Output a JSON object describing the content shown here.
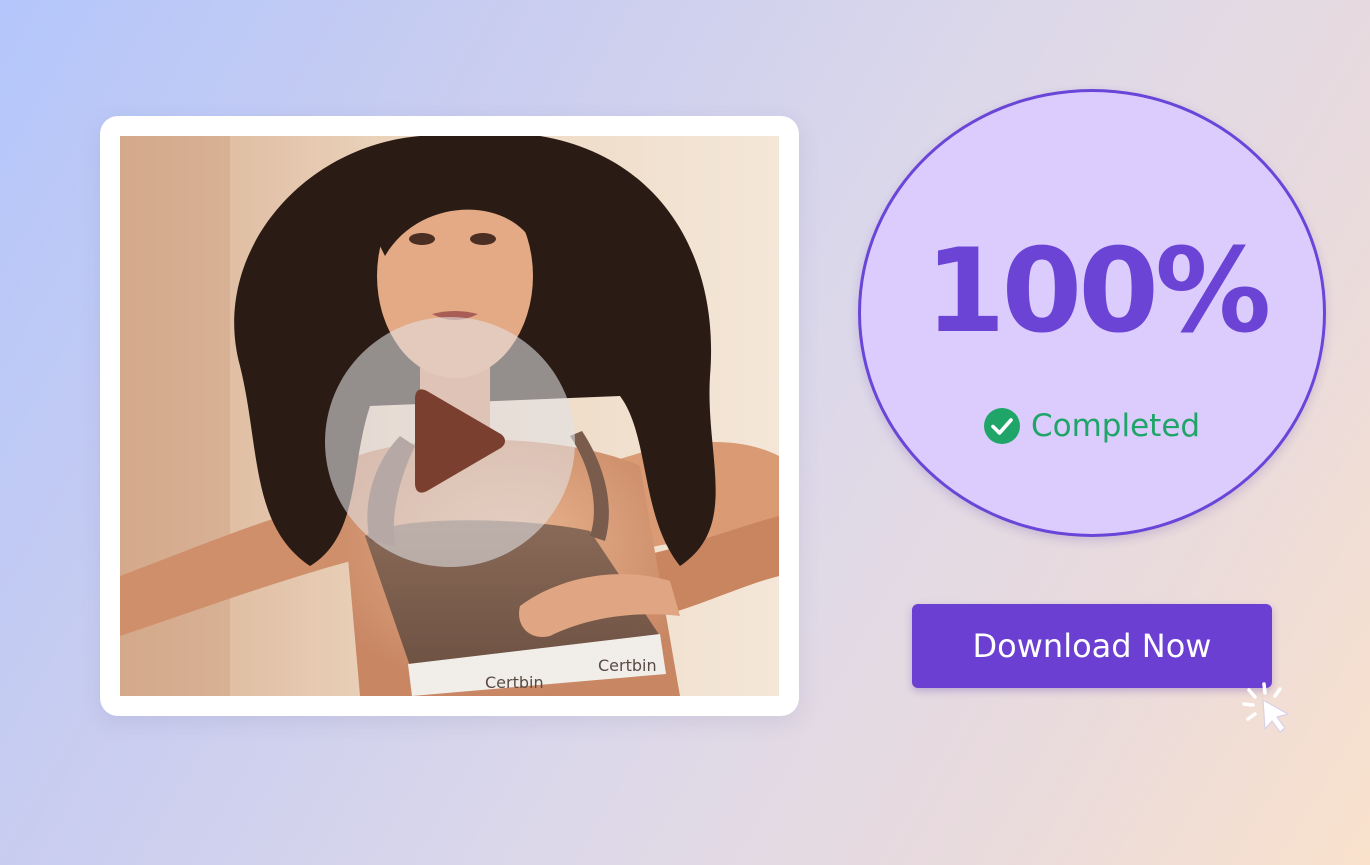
{
  "video": {
    "play_icon": "play-icon",
    "waistband_text_left": "Certbin",
    "waistband_text_right": "Certbin"
  },
  "progress": {
    "percent_label": "100%",
    "value": 100,
    "status_icon": "check-circle-icon",
    "status_text": "Completed"
  },
  "download_button": {
    "label": "Download Now",
    "cursor_icon": "pointer-cursor-icon"
  },
  "colors": {
    "accent_purple": "#6c3fd3",
    "circle_fill": "#dccbfd",
    "success_green": "#1fa567"
  }
}
